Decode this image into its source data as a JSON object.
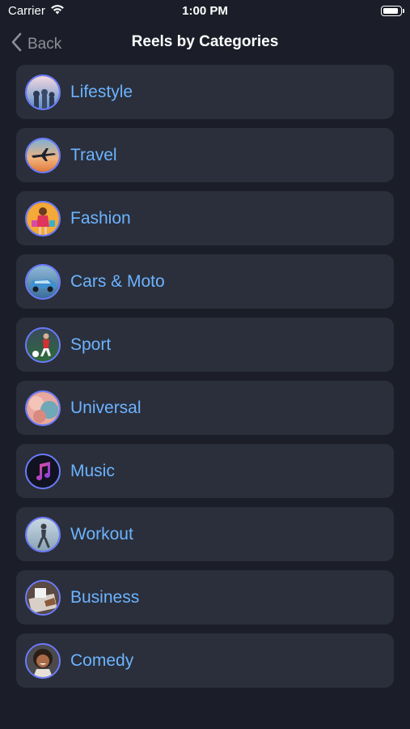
{
  "status": {
    "carrier": "Carrier",
    "time": "1:00 PM"
  },
  "nav": {
    "back_label": "Back",
    "title": "Reels by Categories"
  },
  "categories": [
    {
      "label": "Lifestyle",
      "icon": "lifestyle-image-icon"
    },
    {
      "label": "Travel",
      "icon": "travel-image-icon"
    },
    {
      "label": "Fashion",
      "icon": "fashion-image-icon"
    },
    {
      "label": "Cars & Moto",
      "icon": "cars-moto-image-icon"
    },
    {
      "label": "Sport",
      "icon": "sport-image-icon"
    },
    {
      "label": "Universal",
      "icon": "universal-image-icon"
    },
    {
      "label": "Music",
      "icon": "music-image-icon"
    },
    {
      "label": "Workout",
      "icon": "workout-image-icon"
    },
    {
      "label": "Business",
      "icon": "business-image-icon"
    },
    {
      "label": "Comedy",
      "icon": "comedy-image-icon"
    }
  ],
  "colors": {
    "background": "#1b1e28",
    "row": "#2a2f3b",
    "label": "#6db3ff",
    "thumb_ring": "#6d7cff"
  }
}
